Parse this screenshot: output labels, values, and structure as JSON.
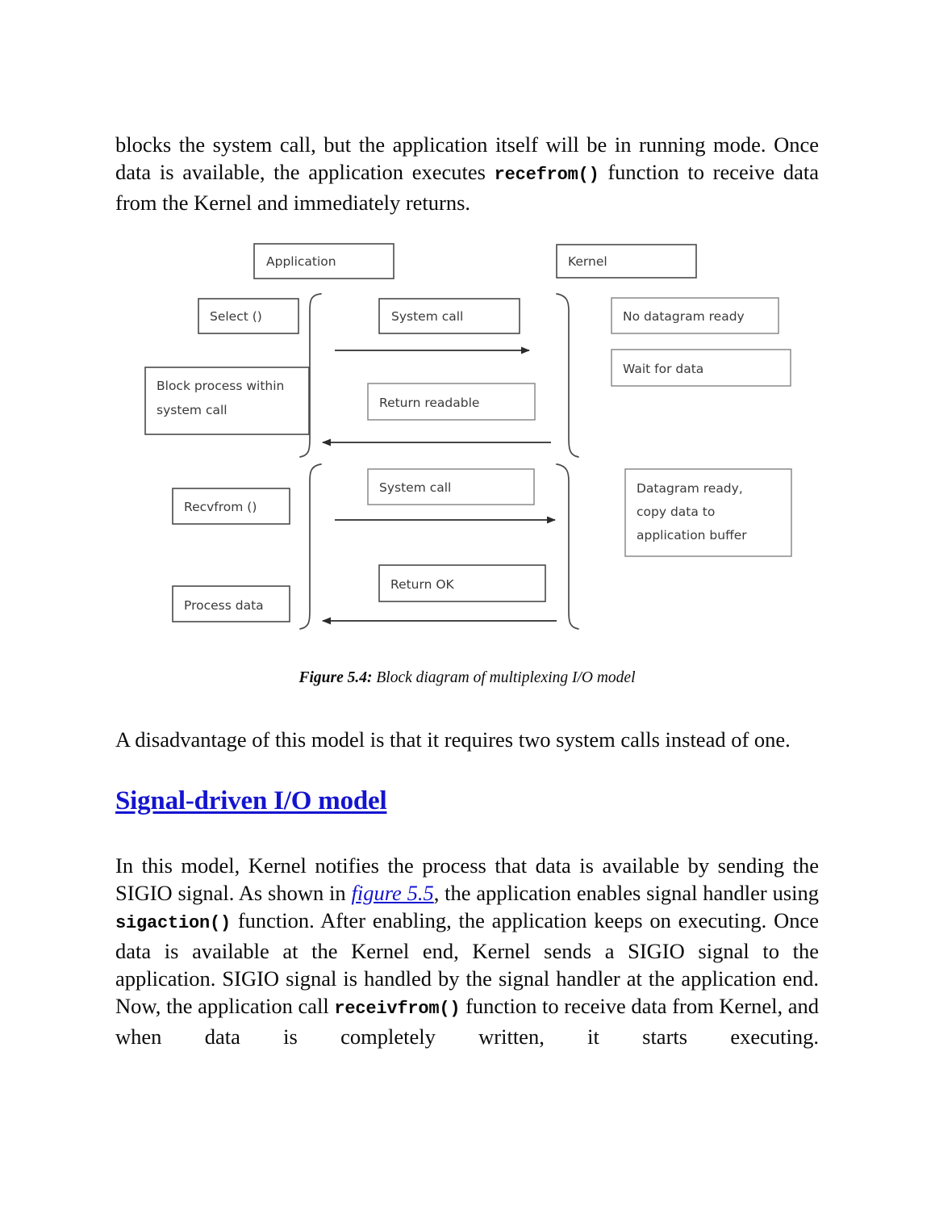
{
  "document": {
    "paragraph_top": {
      "part1": "blocks the system call, but the application itself will be in running mode. Once data is available, the application executes ",
      "code1": "recefrom()",
      "part2": " function to receive data from the Kernel and immediately returns."
    },
    "figure": {
      "caption_label": "Figure 5.4:",
      "caption_text": " Block diagram of multiplexing I/O model",
      "boxes": {
        "application": "Application",
        "kernel": "Kernel",
        "select": "Select ()",
        "block_process": "Block process within system call",
        "block_process_line1": "Block process within",
        "block_process_line2": "system call",
        "system_call_1": "System call",
        "return_readable": "Return readable",
        "no_datagram_ready": "No datagram ready",
        "wait_for_data": "Wait for data",
        "recvfrom": "Recvfrom ()",
        "process_data": "Process data",
        "system_call_2": "System call",
        "return_ok": "Return OK",
        "datagram_ready_line1": "Datagram ready,",
        "datagram_ready_line2": "copy data to",
        "datagram_ready_line3": "application buffer"
      }
    },
    "paragraph_disadvantage": "A disadvantage of this model is that it requires two system calls instead of one.",
    "heading": "Signal-driven I/O model",
    "paragraph_bottom": {
      "part1": "In this model, Kernel notifies the process that data is available by sending the SIGIO signal. As shown in ",
      "link": "figure 5.5",
      "part2": ", the application enables signal handler using ",
      "code1": "sigaction()",
      "part3": " function. After enabling, the application keeps on executing. Once data is available at the Kernel end, Kernel sends a SIGIO signal to the application. SIGIO signal is handled by the signal handler at the application end. Now, the application call ",
      "code2": "receivfrom()",
      "part4": " function to receive data from Kernel, and when data is completely written, it starts executing."
    }
  },
  "colors": {
    "heading_blue": "#1414d0",
    "link_blue": "#1414d0",
    "diagram_stroke": "#3f3f3f",
    "text_black": "#0b0b0b"
  }
}
